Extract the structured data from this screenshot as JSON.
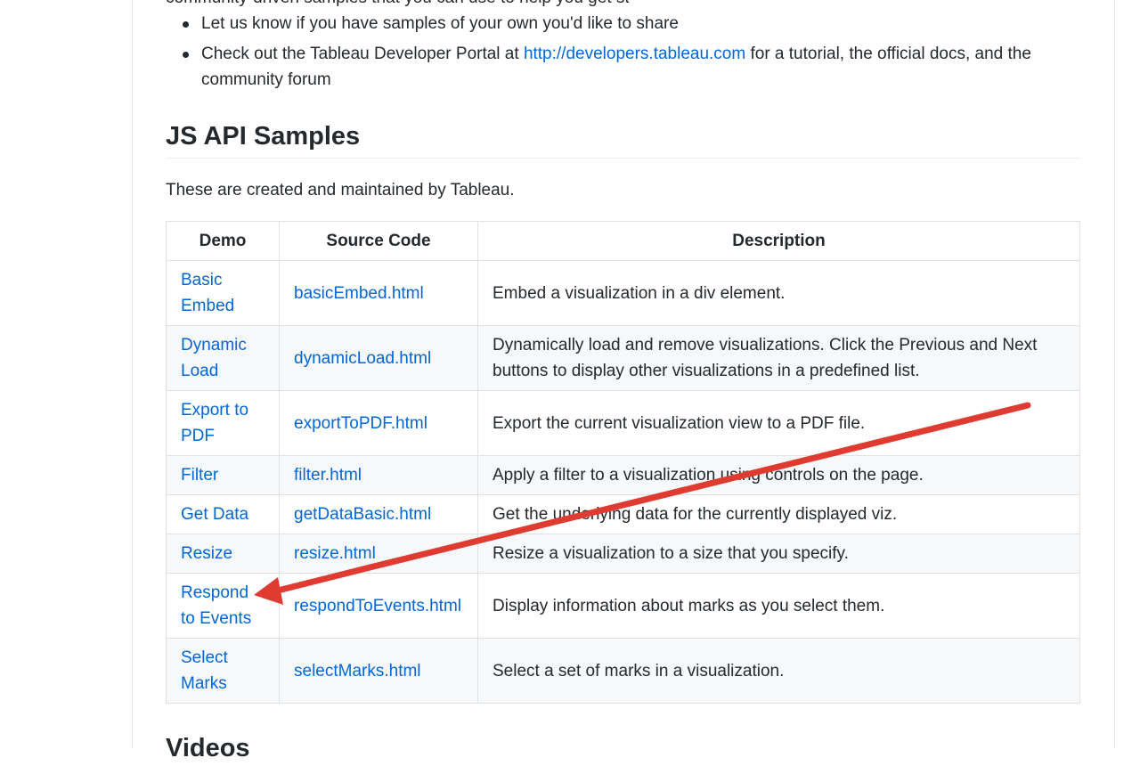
{
  "page": {
    "clipped_top_line": "community-driven samples that you can use to help you get started with the JS API",
    "intro_items": [
      {
        "text": "Let us know if you have samples of your own you'd like to share"
      },
      {
        "before": "Check out the Tableau Developer Portal at ",
        "link": "http://developers.tableau.com",
        "after": " for a tutorial, the official docs, and the community forum"
      }
    ]
  },
  "section": {
    "heading": "JS API Samples",
    "intro": "These are created and maintained by Tableau."
  },
  "table": {
    "headers": [
      "Demo",
      "Source Code",
      "Description"
    ],
    "rows": [
      {
        "demo": "Basic Embed",
        "source": "basicEmbed.html",
        "description": "Embed a visualization in a div element."
      },
      {
        "demo": "Dynamic Load",
        "source": "dynamicLoad.html",
        "description": "Dynamically load and remove visualizations. Click the Previous and Next buttons to display other visualizations in a predefined list."
      },
      {
        "demo": "Export to PDF",
        "source": "exportToPDF.html",
        "description": "Export the current visualization view to a PDF file."
      },
      {
        "demo": "Filter",
        "source": "filter.html",
        "description": "Apply a filter to a visualization using controls on the page."
      },
      {
        "demo": "Get Data",
        "source": "getDataBasic.html",
        "description": "Get the underlying data for the currently displayed viz."
      },
      {
        "demo": "Resize",
        "source": "resize.html",
        "description": "Resize a visualization to a size that you specify."
      },
      {
        "demo": "Respond to Events",
        "source": "respondToEvents.html",
        "description": "Display information about marks as you select them."
      },
      {
        "demo": "Select Marks",
        "source": "selectMarks.html",
        "description": "Select a set of marks in a visualization."
      }
    ]
  },
  "next_heading": "Videos",
  "annotation": {
    "arrow_color": "#e03b30",
    "icon": "arrow-annotation-icon"
  },
  "colors": {
    "text": "#24292e",
    "link": "#0366d6",
    "border": "#dfe2e5",
    "row_alt": "#f6f8fa"
  }
}
